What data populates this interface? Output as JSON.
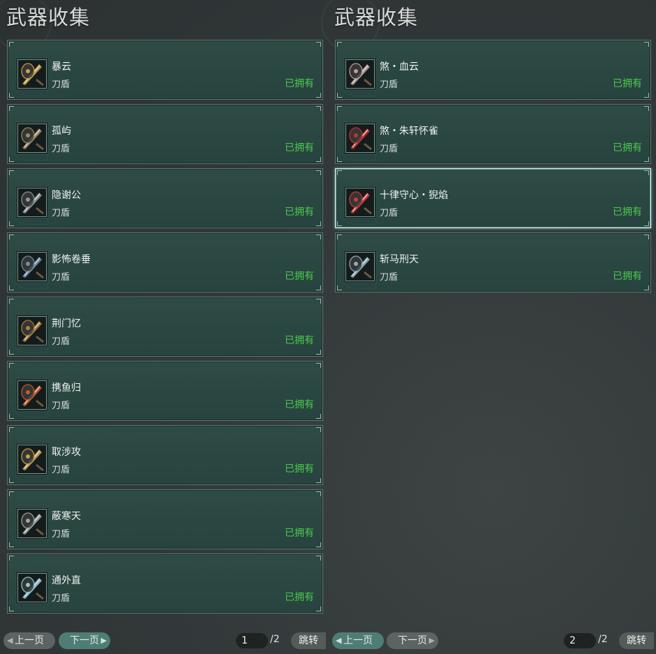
{
  "panels": [
    {
      "title": "武器收集",
      "items": [
        {
          "name": "暴云",
          "type": "刀盾",
          "status": "已拥有",
          "icon": "blade-shield-icon",
          "accent": "#c9a24a"
        },
        {
          "name": "孤屿",
          "type": "刀盾",
          "status": "已拥有",
          "icon": "blade-shield-icon",
          "accent": "#9a8a6a"
        },
        {
          "name": "隐谢公",
          "type": "刀盾",
          "status": "已拥有",
          "icon": "blade-shield-icon",
          "accent": "#8d97a0"
        },
        {
          "name": "影怖卷垂",
          "type": "刀盾",
          "status": "已拥有",
          "icon": "blade-shield-icon",
          "accent": "#6e8fb0"
        },
        {
          "name": "荆门忆",
          "type": "刀盾",
          "status": "已拥有",
          "icon": "blade-shield-icon",
          "accent": "#b08040"
        },
        {
          "name": "携鱼归",
          "type": "刀盾",
          "status": "已拥有",
          "icon": "blade-shield-icon",
          "accent": "#c85a30"
        },
        {
          "name": "取涉攻",
          "type": "刀盾",
          "status": "已拥有",
          "icon": "blade-shield-icon",
          "accent": "#c8a050"
        },
        {
          "name": "蔽寒天",
          "type": "刀盾",
          "status": "已拥有",
          "icon": "blade-shield-icon",
          "accent": "#a0a4a6"
        },
        {
          "name": "通外直",
          "type": "刀盾",
          "status": "已拥有",
          "icon": "blade-shield-icon",
          "accent": "#8cc8d8"
        }
      ],
      "pager": {
        "prev": "上一页",
        "next": "下一页",
        "page": "1",
        "total": "/2",
        "jump": "跳转",
        "active": "next"
      }
    },
    {
      "title": "武器收集",
      "items": [
        {
          "name": "煞・血云",
          "type": "刀盾",
          "status": "已拥有",
          "icon": "blade-shield-icon",
          "accent": "#b8a0a0"
        },
        {
          "name": "煞・朱轩怀雀",
          "type": "刀盾",
          "status": "已拥有",
          "icon": "blade-shield-icon",
          "accent": "#c83030"
        },
        {
          "name": "十律守心・猊焰",
          "type": "刀盾",
          "status": "已拥有",
          "icon": "blade-shield-icon",
          "accent": "#d03838",
          "selected": true
        },
        {
          "name": "斩马刑天",
          "type": "刀盾",
          "status": "已拥有",
          "icon": "blade-shield-icon",
          "accent": "#8ab0c0"
        }
      ],
      "pager": {
        "prev": "上一页",
        "next": "下一页",
        "page": "2",
        "total": "/2",
        "jump": "跳转",
        "active": "prev"
      }
    }
  ],
  "colors": {
    "owned": "#49cc4d",
    "card": "#2e4b45",
    "selected_border": "#c9f4ec"
  }
}
